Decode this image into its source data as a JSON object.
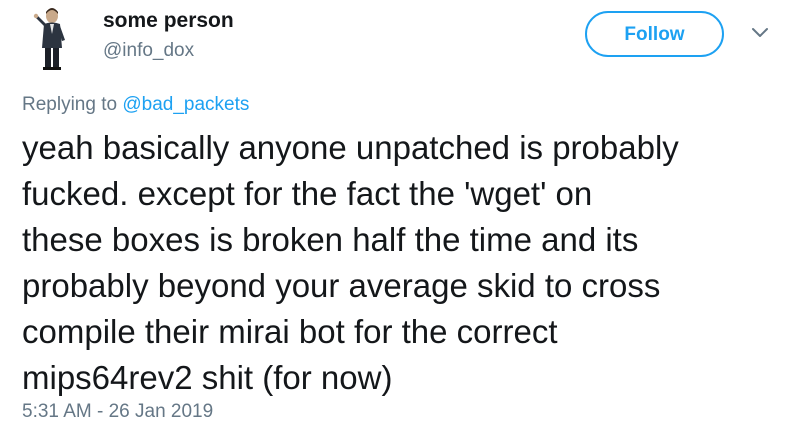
{
  "author": {
    "display_name": "some person",
    "handle": "@info_dox",
    "avatar_icon": "person-figure-avatar"
  },
  "follow_button": {
    "label": "Follow"
  },
  "menu": {
    "icon": "chevron-down-icon"
  },
  "reply": {
    "prefix": "Replying to ",
    "mention": "@bad_packets"
  },
  "tweet": {
    "lines": [
      "yeah basically anyone unpatched is probably",
      "fucked. except for the fact the 'wget' on",
      "these boxes is broken half the time and its",
      "probably beyond your average skid to cross",
      "compile their mirai bot for the correct",
      "mips64rev2 shit (for now)"
    ]
  },
  "meta": {
    "timestamp": "5:31 AM - 26 Jan 2019"
  },
  "colors": {
    "accent": "#1da1f2",
    "secondary_text": "#657786",
    "primary_text": "#14171a"
  }
}
